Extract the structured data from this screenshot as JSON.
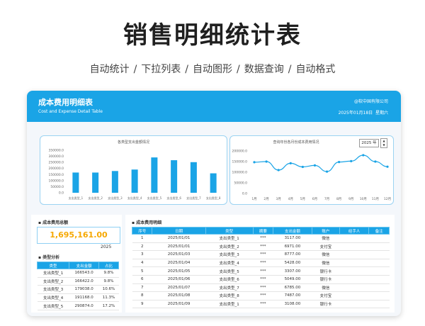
{
  "title": "销售明细统计表",
  "features": [
    "自动统计",
    "下拉列表",
    "自动图形",
    "数据查询",
    "自动格式"
  ],
  "separator": "/",
  "sheet": {
    "title": "成本费用明细表",
    "subtitle_en": "Cost and Expense Detail Table",
    "company": "@软中国有限公司",
    "date": "2025年01月18日",
    "weekday": "星期六"
  },
  "bar_chart_title": "各类型支出金额情况",
  "line_chart_title": "查询年份各月份成本费用情况",
  "year_select": "2025 年",
  "summary": {
    "total_label": "成本费用总额",
    "total_value": "1,695,161.00",
    "year": "2025"
  },
  "type_analysis": {
    "label": "类型分析",
    "headers": [
      "类型",
      "支出金额",
      "占比"
    ],
    "rows": [
      [
        "支出类型_1",
        "166543.0",
        "9.8%"
      ],
      [
        "支出类型_2",
        "166422.0",
        "9.8%"
      ],
      [
        "支出类型_3",
        "179038.0",
        "10.6%"
      ],
      [
        "支出类型_4",
        "191168.0",
        "11.3%"
      ],
      [
        "支出类型_5",
        "290874.0",
        "17.2%"
      ]
    ]
  },
  "detail": {
    "label": "成本费用明细",
    "headers": [
      "序号",
      "日期",
      "类型",
      "摘要",
      "支出金额",
      "账户",
      "经手人",
      "备注"
    ],
    "rows": [
      [
        "1",
        "2025/01/01",
        "支出类型_1",
        "***",
        "3117.00",
        "微信",
        "",
        ""
      ],
      [
        "2",
        "2025/01/01",
        "支出类型_2",
        "***",
        "6971.00",
        "支付宝",
        "",
        ""
      ],
      [
        "3",
        "2025/01/03",
        "支出类型_3",
        "***",
        "8777.00",
        "微信",
        "",
        ""
      ],
      [
        "4",
        "2025/01/04",
        "支出类型_4",
        "***",
        "5428.00",
        "微信",
        "",
        ""
      ],
      [
        "5",
        "2025/01/05",
        "支出类型_5",
        "***",
        "3307.00",
        "银行卡",
        "",
        ""
      ],
      [
        "6",
        "2025/01/06",
        "支出类型_6",
        "***",
        "5049.00",
        "银行卡",
        "",
        ""
      ],
      [
        "7",
        "2025/01/07",
        "支出类型_7",
        "***",
        "6785.00",
        "微信",
        "",
        ""
      ],
      [
        "8",
        "2025/01/08",
        "支出类型_8",
        "***",
        "7487.00",
        "支付宝",
        "",
        ""
      ],
      [
        "9",
        "2025/01/09",
        "支出类型_1",
        "***",
        "3108.00",
        "银行卡",
        "",
        ""
      ]
    ]
  },
  "colors": {
    "accent": "#1aa4e6",
    "total": "#f6a800"
  },
  "chart_data": [
    {
      "type": "bar",
      "title": "各类型支出金额情况",
      "categories": [
        "支出类型_1",
        "支出类型_2",
        "支出类型_3",
        "支出类型_4",
        "支出类型_5",
        "支出类型_6",
        "支出类型_7",
        "支出类型_8"
      ],
      "values": [
        166543,
        166422,
        179038,
        191168,
        290874,
        268000,
        252000,
        160000
      ],
      "ylim": [
        0,
        350000
      ],
      "yticks": [
        "0.0",
        "50000.0",
        "100000.0",
        "150000.0",
        "200000.0",
        "250000.0",
        "300000.0",
        "350000.0"
      ],
      "color": "#1aa4e6"
    },
    {
      "type": "line",
      "title": "查询年份各月份成本费用情况",
      "categories": [
        "1月",
        "2月",
        "3月",
        "4月",
        "5月",
        "6月",
        "7月",
        "8月",
        "9月",
        "10月",
        "11月",
        "12月"
      ],
      "values": [
        147000,
        150000,
        110000,
        142000,
        125000,
        132000,
        103000,
        148000,
        152000,
        180000,
        150000,
        126000
      ],
      "ylim": [
        0,
        200000
      ],
      "yticks": [
        "0.0",
        "50000.0",
        "100000.0",
        "150000.0",
        "200000.0"
      ],
      "color": "#1aa4e6"
    }
  ]
}
